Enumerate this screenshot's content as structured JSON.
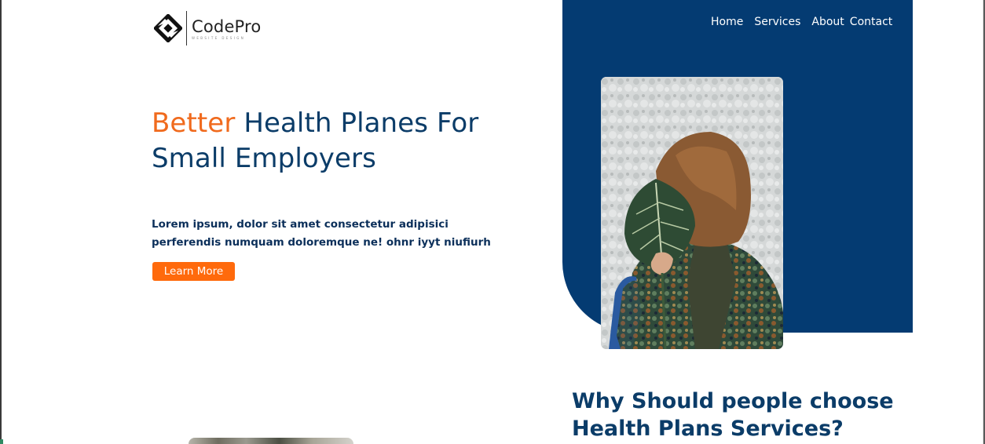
{
  "brand": {
    "name": "CodePro",
    "tagline": "WEBSITE DESIGN"
  },
  "nav": {
    "items": [
      "Home",
      "Services",
      "About",
      "Contact"
    ]
  },
  "hero": {
    "title_accent": "Better",
    "title_rest": " Health Planes For Small Employers",
    "description": "Lorem ipsum, dolor sit amet consectetur adipisici perferendis numquam doloremque ne! ohnr iyyt niufiurh",
    "cta_label": "Learn More"
  },
  "why": {
    "title": "Why Should people choose Health Plans Services?"
  },
  "colors": {
    "primary_blue": "#043b72",
    "heading_blue": "#0b3c68",
    "accent_orange": "#f06a1d",
    "button_orange": "#ff6a0c"
  },
  "images": {
    "hero_photo": "woman-holding-leaf-photo",
    "bottom_photo": "office-photo-thumbnail"
  }
}
